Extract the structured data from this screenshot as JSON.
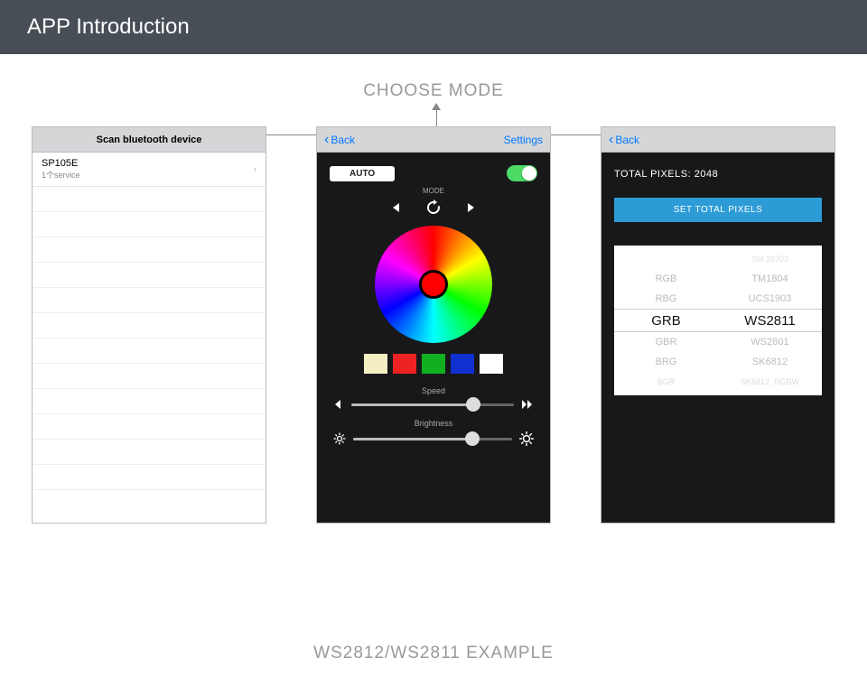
{
  "header": {
    "title": "APP Introduction"
  },
  "labels": {
    "choose_mode": "CHOOSE MODE",
    "example": "WS2812/WS2811 EXAMPLE"
  },
  "screen1": {
    "title": "Scan bluetooth device",
    "device": {
      "name": "SP105E",
      "sub": "1个service"
    }
  },
  "screen2": {
    "back": "Back",
    "settings": "Settings",
    "auto": "AUTO",
    "mode": "MODE",
    "speed": "Speed",
    "brightness": "Brightness"
  },
  "screen3": {
    "back": "Back",
    "pixels": "TOTAL PIXELS:  2048",
    "set_btn": "SET TOTAL PIXELS",
    "wheel": {
      "rows": [
        {
          "a": "",
          "b": "SM 16703",
          "faded": true
        },
        {
          "a": "RGB",
          "b": "TM1804"
        },
        {
          "a": "RBG",
          "b": "UCS1903"
        },
        {
          "a": "GRB",
          "b": "WS2811",
          "selected": true
        },
        {
          "a": "GBR",
          "b": "WS2801"
        },
        {
          "a": "BRG",
          "b": "SK6812"
        },
        {
          "a": "BGR",
          "b": "SK6812_RGBW",
          "faded": true
        }
      ]
    }
  },
  "swatches": [
    "#f4eec3",
    "#ee2222",
    "#10b020",
    "#1030d0",
    "#ffffff"
  ]
}
